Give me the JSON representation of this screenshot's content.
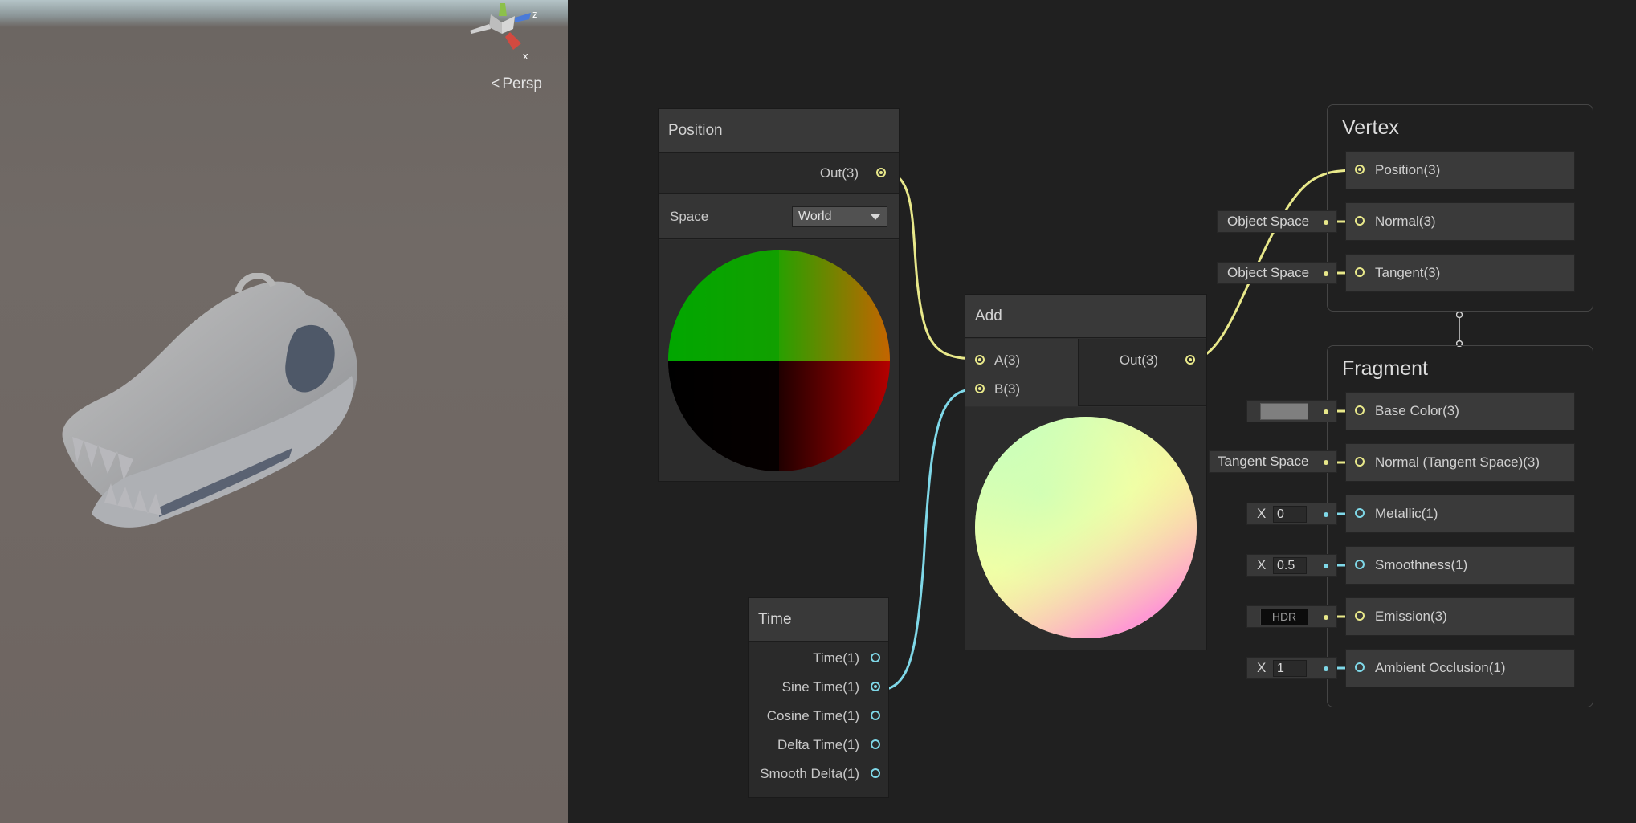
{
  "scene": {
    "view_mode": "Persp",
    "view_arrow": "<",
    "gizmo_axes": {
      "z": "z",
      "x": "x"
    },
    "model_icon": "skull-model"
  },
  "colors": {
    "vector_port": "#e8e88a",
    "float_port": "#7fd8e8",
    "node_background": "#2f2f2f",
    "graph_background": "#202020"
  },
  "nodes": {
    "position": {
      "title": "Position",
      "output_label": "Out(3)",
      "space_label": "Space",
      "space_value": "World"
    },
    "add": {
      "title": "Add",
      "input_a": "A(3)",
      "input_b": "B(3)",
      "output_label": "Out(3)"
    },
    "time": {
      "title": "Time",
      "outputs": [
        "Time(1)",
        "Sine Time(1)",
        "Cosine Time(1)",
        "Delta Time(1)",
        "Smooth Delta(1)"
      ]
    }
  },
  "master": {
    "vertex": {
      "title": "Vertex",
      "blocks": [
        "Position(3)",
        "Normal(3)",
        "Tangent(3)"
      ],
      "normal_input": "Object Space",
      "tangent_input": "Object Space"
    },
    "fragment": {
      "title": "Fragment",
      "blocks": [
        "Base Color(3)",
        "Normal (Tangent Space)(3)",
        "Metallic(1)",
        "Smoothness(1)",
        "Emission(3)",
        "Ambient Occlusion(1)"
      ],
      "base_color_value": "#7f7f7f",
      "normal_input": "Tangent Space",
      "metallic_label": "X",
      "metallic_value": "0",
      "smoothness_label": "X",
      "smoothness_value": "0.5",
      "emission_label": "HDR",
      "ao_label": "X",
      "ao_value": "1"
    }
  }
}
